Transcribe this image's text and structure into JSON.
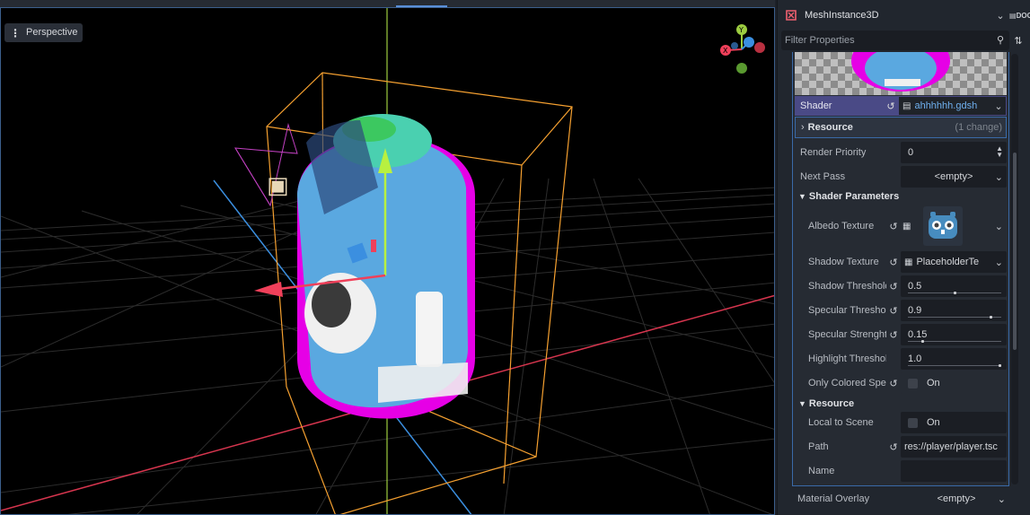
{
  "viewport": {
    "mode_label": "Perspective",
    "gizmo": {
      "y": "Y",
      "x": "X"
    }
  },
  "inspector": {
    "node_type": "MeshInstance3D",
    "filter_placeholder": "Filter Properties",
    "doc_label": "DOC",
    "shader": {
      "label": "Shader",
      "value": "ahhhhhh.gdsh"
    },
    "resource_sub": {
      "label": "Resource",
      "changes": "(1 change)"
    },
    "render_priority": {
      "label": "Render Priority",
      "value": "0"
    },
    "next_pass": {
      "label": "Next Pass",
      "value": "<empty>"
    },
    "shader_parameters": {
      "title": "Shader Parameters",
      "albedo_texture": {
        "label": "Albedo Texture"
      },
      "shadow_texture": {
        "label": "Shadow Texture",
        "value": "PlaceholderTe"
      },
      "shadow_threshold": {
        "label": "Shadow Threshold",
        "value": "0.5",
        "fraction": 0.5
      },
      "specular_threshold": {
        "label": "Specular Threshol",
        "value": "0.9",
        "fraction": 0.9
      },
      "specular_strenght": {
        "label": "Specular Strenght",
        "value": "0.15",
        "fraction": 0.15
      },
      "highlight_threshold": {
        "label": "Highlight Threshold",
        "value": "1.0",
        "fraction": 1.0
      },
      "only_colored_spec": {
        "label": "Only Colored Spec",
        "value": "On"
      }
    },
    "resource": {
      "title": "Resource",
      "local_to_scene": {
        "label": "Local to Scene",
        "value": "On"
      },
      "path": {
        "label": "Path",
        "value": "res://player/player.tsc"
      },
      "name": {
        "label": "Name",
        "value": ""
      }
    },
    "material_overlay": {
      "label": "Material Overlay",
      "value": "<empty>"
    }
  },
  "colors": {
    "accent": "#3a6aa8",
    "shader_row": "#4a4a86",
    "selection_box": "#f5a030",
    "capsule": "#e600e6"
  }
}
